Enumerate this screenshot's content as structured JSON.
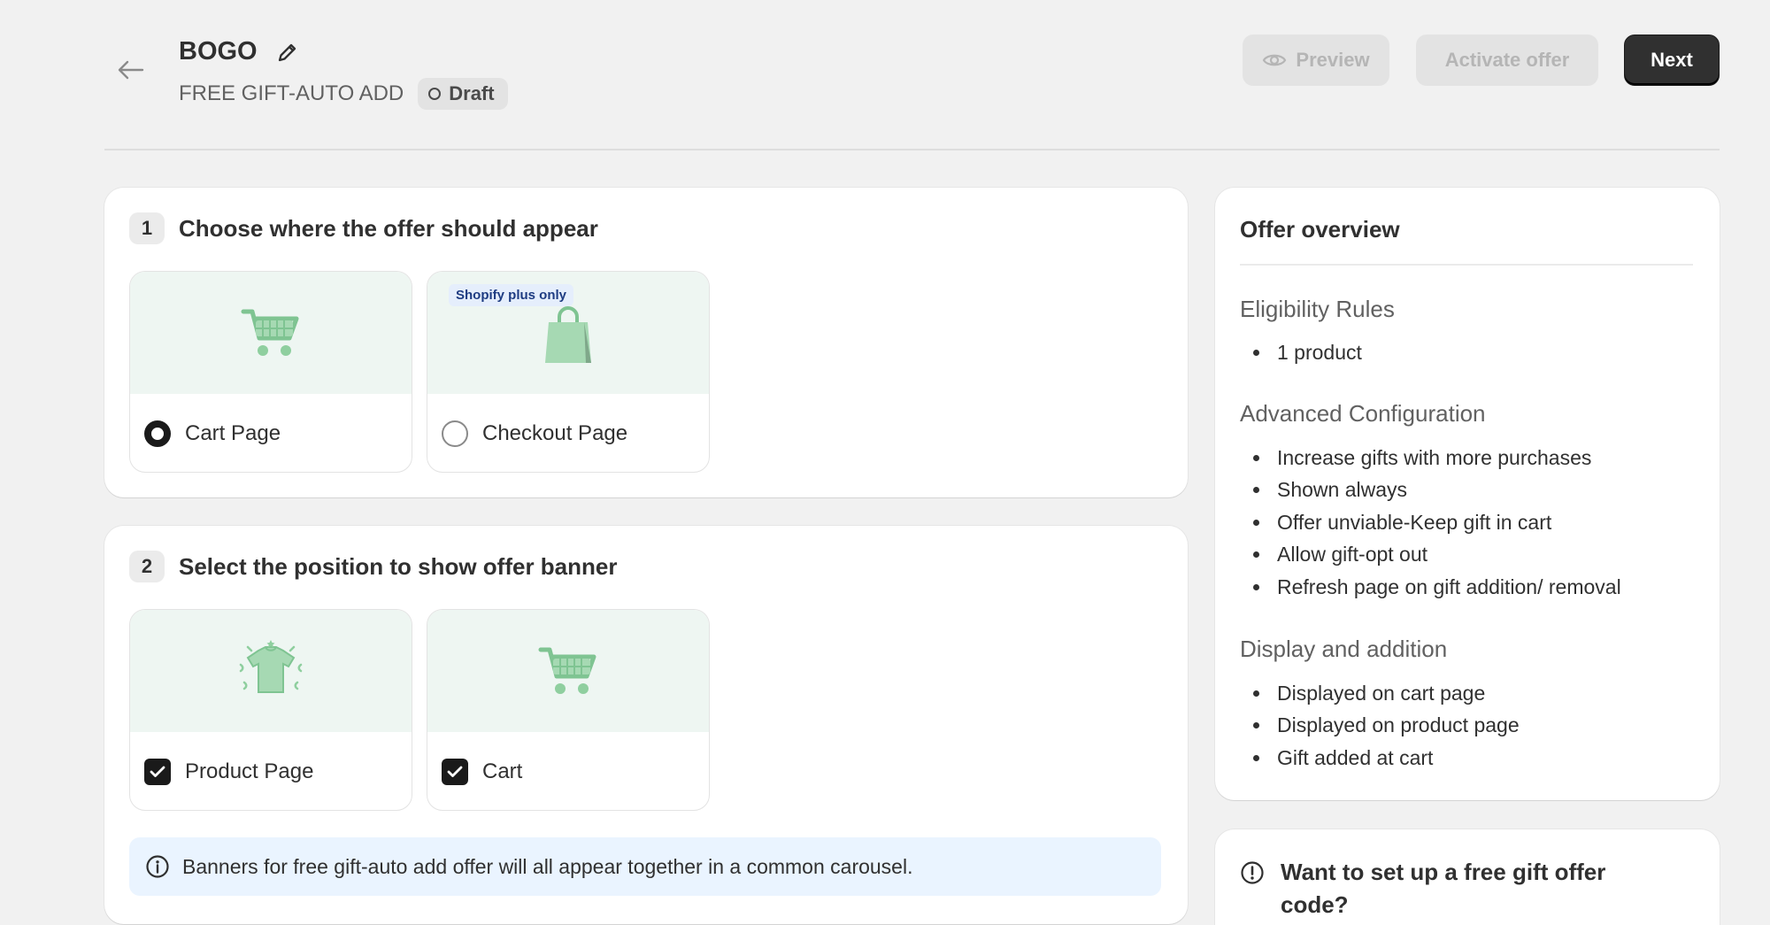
{
  "header": {
    "title": "BOGO",
    "subtitle": "FREE GIFT-AUTO ADD",
    "status": "Draft",
    "preview_label": "Preview",
    "activate_label": "Activate offer",
    "next_label": "Next"
  },
  "section1": {
    "number": "1",
    "title": "Choose where the offer should appear",
    "options": [
      {
        "label": "Cart Page",
        "selected": true,
        "icon": "shopping-cart-icon"
      },
      {
        "label": "Checkout Page",
        "selected": false,
        "tag": "Shopify plus only",
        "icon": "shopping-bag-icon"
      }
    ]
  },
  "section2": {
    "number": "2",
    "title": "Select the position to show offer banner",
    "options": [
      {
        "label": "Product Page",
        "checked": true,
        "icon": "tshirt-icon"
      },
      {
        "label": "Cart",
        "checked": true,
        "icon": "shopping-cart-icon"
      }
    ],
    "info": "Banners for free gift-auto add offer will all appear together in a common carousel."
  },
  "overview": {
    "title": "Offer overview",
    "groups": [
      {
        "heading": "Eligibility Rules",
        "items": [
          "1 product"
        ]
      },
      {
        "heading": "Advanced Configuration",
        "items": [
          "Increase gifts with more purchases",
          "Shown always",
          "Offer unviable-Keep gift in cart",
          "Allow gift-opt out",
          "Refresh page on gift addition/ removal"
        ]
      },
      {
        "heading": "Display and addition",
        "items": [
          "Displayed on cart page",
          "Displayed on product page",
          "Gift added at cart"
        ]
      }
    ]
  },
  "promo": {
    "text": "Want to set up a free gift offer code?"
  },
  "colors": {
    "accent_dark": "#303030",
    "cart_green": "#8fcf9f",
    "info_bg": "#eaf4ff"
  }
}
